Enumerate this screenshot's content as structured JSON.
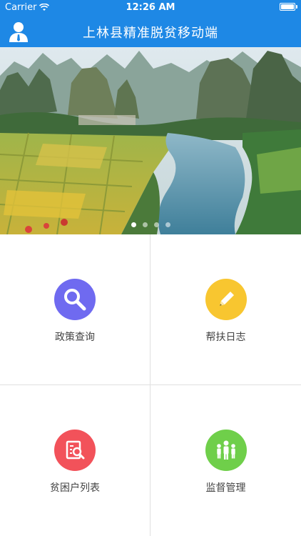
{
  "status_bar": {
    "carrier": "Carrier",
    "time": "12:26 AM"
  },
  "header": {
    "title": "上林县精准脱贫移动端",
    "avatar_icon": "user-icon"
  },
  "banner": {
    "slide_count": 4,
    "active_slide": 1
  },
  "menu": [
    {
      "label": "政策查询",
      "icon": "search-icon",
      "color": "#6f6af0"
    },
    {
      "label": "帮扶日志",
      "icon": "pencil-icon",
      "color": "#f8c630"
    },
    {
      "label": "贫困户列表",
      "icon": "list-search-icon",
      "color": "#f2525a"
    },
    {
      "label": "监督管理",
      "icon": "people-icon",
      "color": "#6fcf4a"
    }
  ],
  "colors": {
    "header_bg": "#1e88e5",
    "divider": "#e0e0e0"
  }
}
